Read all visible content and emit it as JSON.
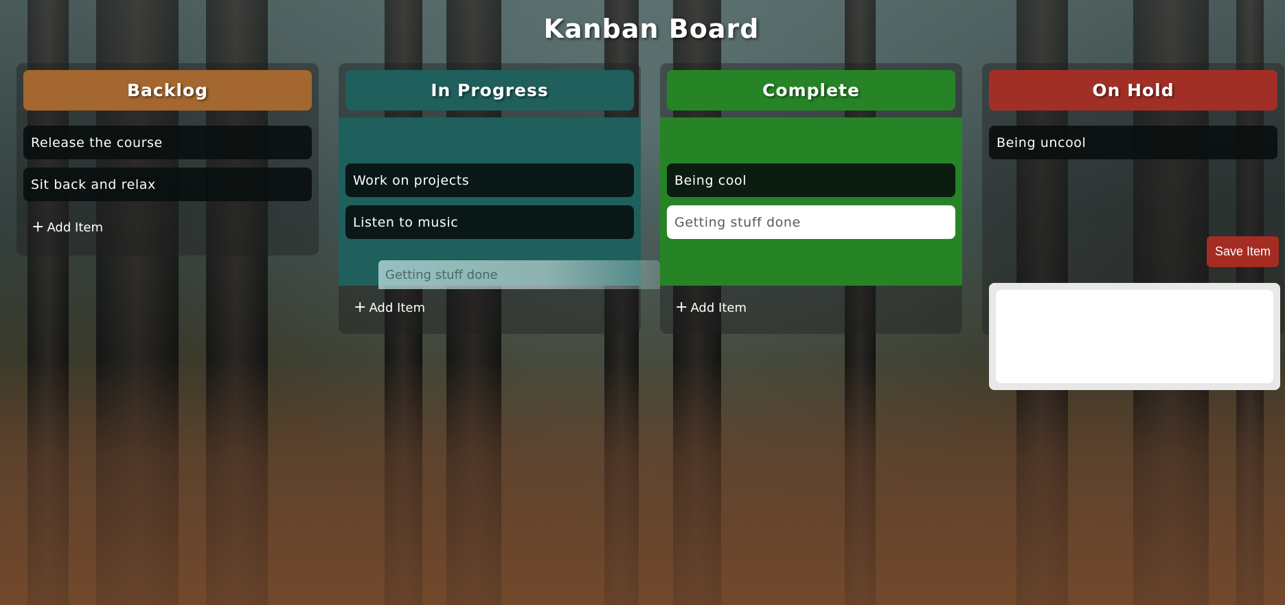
{
  "page": {
    "title": "Kanban Board"
  },
  "columns": [
    {
      "title": "Backlog",
      "color": "#a3672f",
      "items": [
        "Release the course",
        "Sit back and relax"
      ],
      "add_label": "Add Item"
    },
    {
      "title": "In Progress",
      "color": "#1f5f5c",
      "items": [
        "Work on projects",
        "Listen to music"
      ],
      "dragging_item": "Getting stuff done",
      "add_label": "Add Item"
    },
    {
      "title": "Complete",
      "color": "#268426",
      "items": [
        "Being cool"
      ],
      "editing_item": "Getting stuff done",
      "add_label": "Add Item"
    },
    {
      "title": "On Hold",
      "color": "#a22f25",
      "items": [
        "Being uncool"
      ],
      "save_label": "Save Item",
      "textarea_value": ""
    }
  ]
}
